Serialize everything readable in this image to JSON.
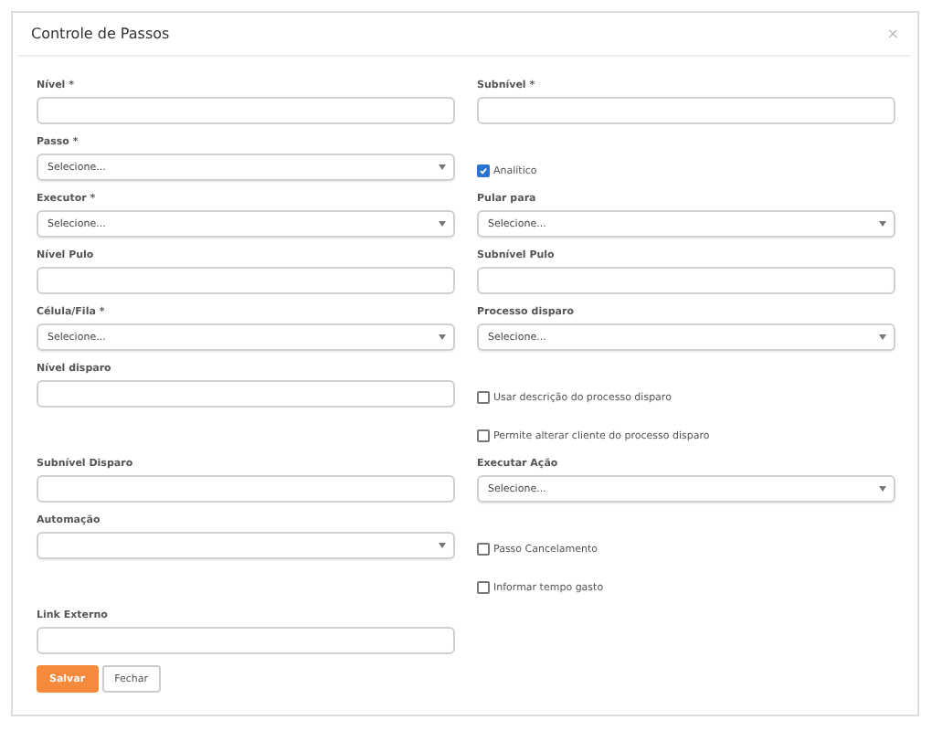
{
  "dialog": {
    "title": "Controle de Passos",
    "close": "×"
  },
  "fields": [
    {
      "kind": "text",
      "label": "Nível *"
    },
    {
      "kind": "text",
      "label": "Subnível *"
    },
    {
      "kind": "select",
      "label": "Passo *",
      "value": "Selecione..."
    },
    {
      "kind": "checkbox",
      "label": "Analítico",
      "checked": true
    },
    {
      "kind": "select",
      "label": "Executor *",
      "value": "Selecione..."
    },
    {
      "kind": "select",
      "label": "Pular para",
      "value": "Selecione..."
    },
    {
      "kind": "text",
      "label": "Nível Pulo"
    },
    {
      "kind": "text",
      "label": "Subnível Pulo"
    },
    {
      "kind": "select",
      "label": "Célula/Fila *",
      "value": "Selecione..."
    },
    {
      "kind": "select",
      "label": "Processo disparo",
      "value": "Selecione..."
    },
    {
      "kind": "text",
      "label": "Nível disparo"
    },
    {
      "kind": "checkbox",
      "label": "Usar descrição do processo disparo",
      "checked": false
    },
    {
      "kind": "spacer"
    },
    {
      "kind": "checkbox",
      "label": "Permite alterar cliente do processo disparo",
      "checked": false
    },
    {
      "kind": "text",
      "label": "Subnível Disparo"
    },
    {
      "kind": "select",
      "label": "Executar Ação",
      "value": "Selecione..."
    },
    {
      "kind": "select",
      "label": "Automação"
    },
    {
      "kind": "checkbox",
      "label": "Passo Cancelamento",
      "checked": false
    },
    {
      "kind": "spacer"
    },
    {
      "kind": "checkbox",
      "label": "Informar tempo gasto",
      "checked": false
    },
    {
      "kind": "text",
      "label": "Link Externo"
    }
  ],
  "buttons": [
    {
      "kind": "primary",
      "label": "Salvar"
    },
    {
      "kind": "default",
      "label": "Fechar"
    }
  ]
}
